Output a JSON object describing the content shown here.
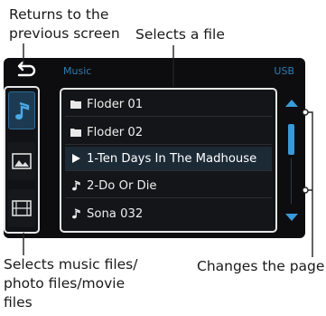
{
  "callouts": {
    "back_line1": "Returns to the",
    "back_line2": "previous screen",
    "file": "Selects a file",
    "media_line1": "Selects music files/",
    "media_line2": "photo files/movie",
    "media_line3": "files",
    "page": "Changes the page"
  },
  "topbar": {
    "source": "Music",
    "device": "USB"
  },
  "list": [
    {
      "icon": "folder-icon",
      "label": "Floder 01",
      "selected": false
    },
    {
      "icon": "folder-icon",
      "label": "Floder 02",
      "selected": false
    },
    {
      "icon": "play-icon",
      "label": "1-Ten Days In The Madhouse",
      "selected": true
    },
    {
      "icon": "music-note-icon",
      "label": "2-Do Or Die",
      "selected": false
    },
    {
      "icon": "music-note-icon",
      "label": "Sona 032",
      "selected": false
    }
  ],
  "colors": {
    "accent": "#3a9ad9",
    "screen_bg": "#0d0d0f",
    "frame": "#e6e6e6"
  }
}
